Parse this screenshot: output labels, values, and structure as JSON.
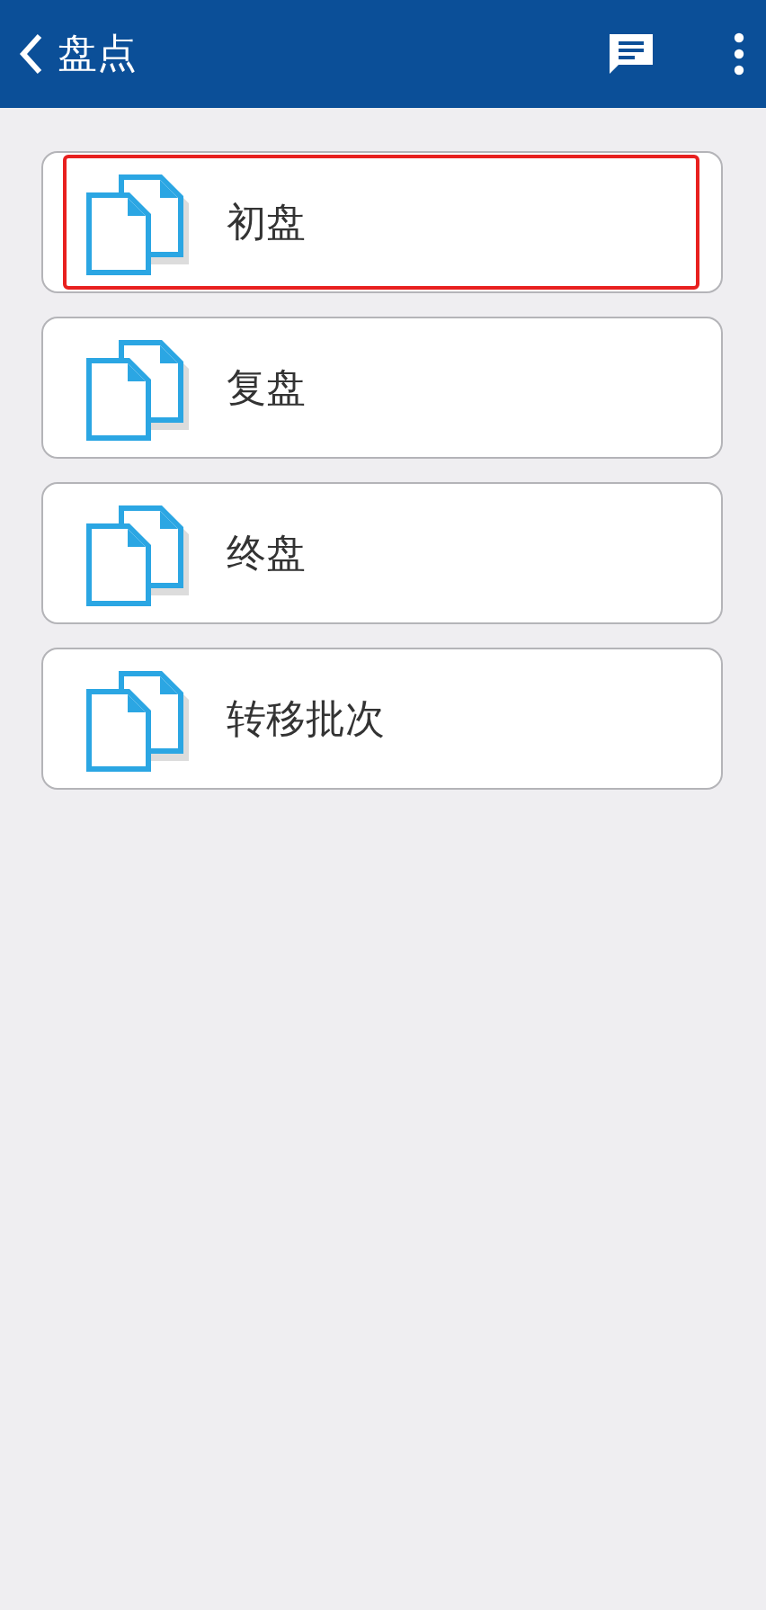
{
  "header": {
    "title": "盘点"
  },
  "items": [
    {
      "label": "初盘",
      "selected": true
    },
    {
      "label": "复盘",
      "selected": false
    },
    {
      "label": "终盘",
      "selected": false
    },
    {
      "label": "转移批次",
      "selected": false
    }
  ]
}
